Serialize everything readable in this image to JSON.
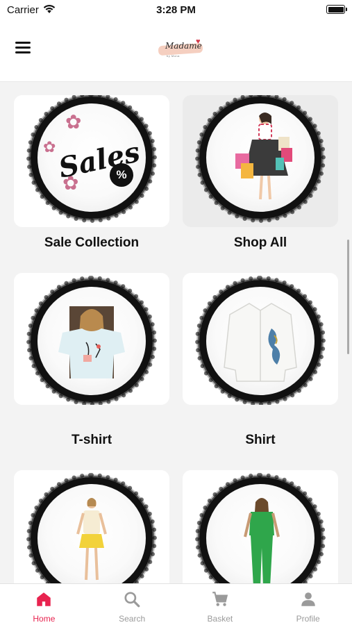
{
  "status_bar": {
    "carrier": "Carrier",
    "time": "3:28 PM"
  },
  "header": {
    "logo_text": "Madame",
    "logo_sub": "by Mona"
  },
  "categories": [
    {
      "label": "Sale Collection",
      "art_text": "Sales",
      "art_badge": "%"
    },
    {
      "label": "Shop All"
    },
    {
      "label": "T-shirt"
    },
    {
      "label": "Shirt"
    },
    {
      "label": ""
    },
    {
      "label": ""
    }
  ],
  "tabbar": {
    "active": "home",
    "items": [
      {
        "id": "home",
        "label": "Home",
        "icon": "home-icon"
      },
      {
        "id": "search",
        "label": "Search",
        "icon": "search-icon"
      },
      {
        "id": "basket",
        "label": "Basket",
        "icon": "cart-icon"
      },
      {
        "id": "profile",
        "label": "Profile",
        "icon": "person-icon"
      }
    ]
  },
  "colors": {
    "accent": "#e8234f",
    "inactive": "#9a9a9a"
  }
}
